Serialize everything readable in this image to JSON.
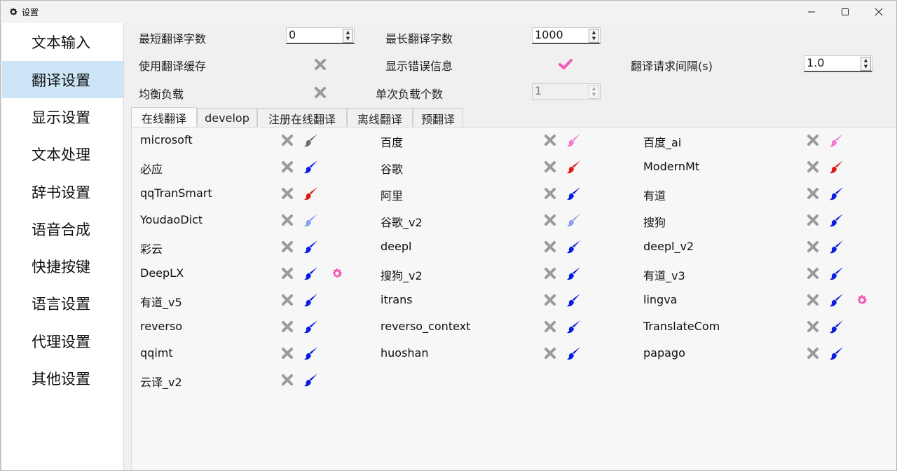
{
  "window": {
    "title": "设置",
    "minimize_glyph": "—",
    "maximize_glyph": "☐",
    "close_glyph": "✕"
  },
  "sidebar": {
    "active_index": 1,
    "items": [
      {
        "label": "文本输入"
      },
      {
        "label": "翻译设置"
      },
      {
        "label": "显示设置"
      },
      {
        "label": "文本处理"
      },
      {
        "label": "辞书设置"
      },
      {
        "label": "语音合成"
      },
      {
        "label": "快捷按键"
      },
      {
        "label": "语言设置"
      },
      {
        "label": "代理设置"
      },
      {
        "label": "其他设置"
      }
    ]
  },
  "settings": {
    "min_chars_label": "最短翻译字数",
    "min_chars_value": "0",
    "max_chars_label": "最长翻译字数",
    "max_chars_value": "1000",
    "use_cache_label": "使用翻译缓存",
    "use_cache_state": "off",
    "show_errors_label": "显示错误信息",
    "show_errors_state": "on",
    "request_interval_label": "翻译请求间隔(s)",
    "request_interval_value": "1.0",
    "load_balance_label": "均衡负载",
    "load_balance_state": "off",
    "per_load_label": "单次负载个数",
    "per_load_value": "1"
  },
  "tabs": [
    {
      "label": "在线翻译",
      "active": true
    },
    {
      "label": "develop",
      "active": false
    },
    {
      "label": "注册在线翻译",
      "active": false
    },
    {
      "label": "离线翻译",
      "active": false
    },
    {
      "label": "预翻译",
      "active": false
    }
  ],
  "colors": {
    "accent_pink": "#f25cb8",
    "x_gray": "#9a9a9a",
    "brush_gray": "#6e6e6e",
    "brush_pink": "#f47ad1",
    "brush_blue": "#0b1ee0",
    "brush_red": "#e01818",
    "brush_lightblue": "#8c9ef0",
    "active_sidebar_bg": "#cde6f7"
  },
  "services": [
    {
      "name": "microsoft",
      "brush": "gray",
      "gear": false
    },
    {
      "name": "百度",
      "brush": "pink",
      "gear": false
    },
    {
      "name": "百度_ai",
      "brush": "pink",
      "gear": false
    },
    {
      "name": "必应",
      "brush": "blue",
      "gear": false
    },
    {
      "name": "谷歌",
      "brush": "red",
      "gear": false
    },
    {
      "name": "ModernMt",
      "brush": "red",
      "gear": false
    },
    {
      "name": "qqTranSmart",
      "brush": "red",
      "gear": false
    },
    {
      "name": "阿里",
      "brush": "blue",
      "gear": false
    },
    {
      "name": "有道",
      "brush": "blue",
      "gear": false
    },
    {
      "name": "YoudaoDict",
      "brush": "lightblue",
      "gear": false
    },
    {
      "name": "谷歌_v2",
      "brush": "lightblue",
      "gear": false
    },
    {
      "name": "搜狗",
      "brush": "blue",
      "gear": false
    },
    {
      "name": "彩云",
      "brush": "blue",
      "gear": false
    },
    {
      "name": "deepl",
      "brush": "blue",
      "gear": false
    },
    {
      "name": "deepl_v2",
      "brush": "blue",
      "gear": false
    },
    {
      "name": "DeepLX",
      "brush": "blue",
      "gear": true
    },
    {
      "name": "搜狗_v2",
      "brush": "blue",
      "gear": false
    },
    {
      "name": "有道_v3",
      "brush": "blue",
      "gear": false
    },
    {
      "name": "有道_v5",
      "brush": "blue",
      "gear": false
    },
    {
      "name": "itrans",
      "brush": "blue",
      "gear": false
    },
    {
      "name": "lingva",
      "brush": "blue",
      "gear": true
    },
    {
      "name": "reverso",
      "brush": "blue",
      "gear": false
    },
    {
      "name": "reverso_context",
      "brush": "blue",
      "gear": false
    },
    {
      "name": "TranslateCom",
      "brush": "blue",
      "gear": false
    },
    {
      "name": "qqimt",
      "brush": "blue",
      "gear": false
    },
    {
      "name": "huoshan",
      "brush": "blue",
      "gear": false
    },
    {
      "name": "papago",
      "brush": "blue",
      "gear": false
    },
    {
      "name": "云译_v2",
      "brush": "blue",
      "gear": false
    }
  ]
}
